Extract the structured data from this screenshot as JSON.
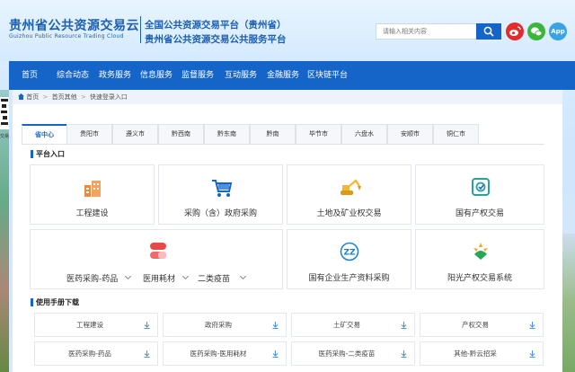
{
  "header": {
    "logo_cn": "贵州省公共资源交易云",
    "logo_en": "Guizhou Public Resource Trading Cloud",
    "platform_line1": "全国公共资源交易平台（贵州省）",
    "platform_line2": "贵州省公共资源交易公共服务平台",
    "search_placeholder": "请输入相关内容",
    "app_label": "App"
  },
  "nav": {
    "items": [
      "首页",
      "综合动态",
      "政务服务",
      "信息服务",
      "监督服务",
      "互动服务",
      "金融服务",
      "区块链平台"
    ]
  },
  "breadcrumb": [
    "首页",
    "首页其他",
    "快速登录入口"
  ],
  "tabs": [
    "省中心",
    "贵阳市",
    "遵义市",
    "黔西南",
    "黔东南",
    "黔南",
    "毕节市",
    "六盘水",
    "安顺市",
    "铜仁市"
  ],
  "platform_section": {
    "title": "平台入口",
    "cards": [
      "工程建设",
      "采购（含）政府采购",
      "土地及矿业权交易",
      "国有产权交易",
      "国有企业生产资料采购",
      "阳光产权交易系统"
    ],
    "medical_items": [
      "医药采购-药品",
      "医用耗材",
      "二类疫苗"
    ]
  },
  "manual_section": {
    "title": "使用手册下载",
    "items": [
      "工程建设",
      "政府采购",
      "土矿交易",
      "产权交易",
      "医药采购-药品",
      "医药采购-医用耗材",
      "医药采购-二类疫苗",
      "其他-黔云招采"
    ]
  },
  "side": {
    "text": "交易"
  },
  "colors": {
    "primary": "#1565c9",
    "accent_orange": "#f08a3a",
    "accent_red": "#e84a4a"
  }
}
